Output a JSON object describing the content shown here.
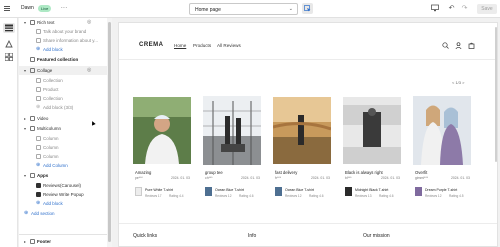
{
  "topbar": {
    "store_name": "Dawn",
    "live_badge": "Live",
    "more": "...",
    "page_select": "Home page",
    "save_label": "Save"
  },
  "sidebar": {
    "rows": [
      {
        "label": "Rich text",
        "kind": "section"
      },
      {
        "label": "Talk about your brand",
        "kind": "block"
      },
      {
        "label": "Share information about y...",
        "kind": "block"
      },
      {
        "label": "Add block",
        "kind": "add"
      },
      {
        "label": "Featured collection",
        "kind": "section-bold"
      },
      {
        "label": "Collage",
        "kind": "section-open"
      },
      {
        "label": "Collection",
        "kind": "block"
      },
      {
        "label": "Product",
        "kind": "block"
      },
      {
        "label": "Collection",
        "kind": "block"
      },
      {
        "label": "Add block (3/3)",
        "kind": "add-disabled"
      },
      {
        "label": "Video",
        "kind": "section"
      },
      {
        "label": "Multicolumn",
        "kind": "section-open"
      },
      {
        "label": "Column",
        "kind": "block"
      },
      {
        "label": "Column",
        "kind": "block"
      },
      {
        "label": "Column",
        "kind": "block"
      },
      {
        "label": "Add Column",
        "kind": "add"
      },
      {
        "label": "Apps",
        "kind": "section-open"
      },
      {
        "label": "Reviews(Carousel)",
        "kind": "block"
      },
      {
        "label": "Review Write Popup",
        "kind": "block"
      },
      {
        "label": "Add block",
        "kind": "add"
      },
      {
        "label": "Add section",
        "kind": "add-section"
      },
      {
        "label": "Footer",
        "kind": "section"
      }
    ]
  },
  "preview": {
    "logo": "CREMA",
    "nav": [
      "Home",
      "Products",
      "All Reviews"
    ],
    "slider_counter": "< 1/3 >",
    "cards": [
      {
        "title": "Amazing",
        "author": "pe***",
        "date": "2024. 01. 03",
        "product": "Pure White T-shirt",
        "reviews": "Reviews 17",
        "rating": "Rating 4.4"
      },
      {
        "title": "group tee",
        "author": "ch***",
        "date": "2024. 01. 03",
        "product": "Ocean Blue T-shirt",
        "reviews": "Reviews 12",
        "rating": "Rating 4.6"
      },
      {
        "title": "fast delivery",
        "author": "fr***",
        "date": "2024. 01. 03",
        "product": "Ocean Blue T-shirt",
        "reviews": "Reviews 12",
        "rating": "Rating 4.6"
      },
      {
        "title": "Black is always right",
        "author": "bl***",
        "date": "2024. 01. 03",
        "product": "Midnight Black T-shirt",
        "reviews": "Reviews 13",
        "rating": "Rating 4.6"
      },
      {
        "title": "Overfit",
        "author": "gimmi***",
        "date": "2024. 01. 03",
        "product": "Dream Purple T-shirt",
        "reviews": "Reviews 12",
        "rating": "Rating 4.5"
      }
    ],
    "footer": [
      "Quick links",
      "Info",
      "Our mission"
    ]
  },
  "colors": {
    "accent": "#2c6ecb",
    "live_bg": "#aee9c5"
  }
}
